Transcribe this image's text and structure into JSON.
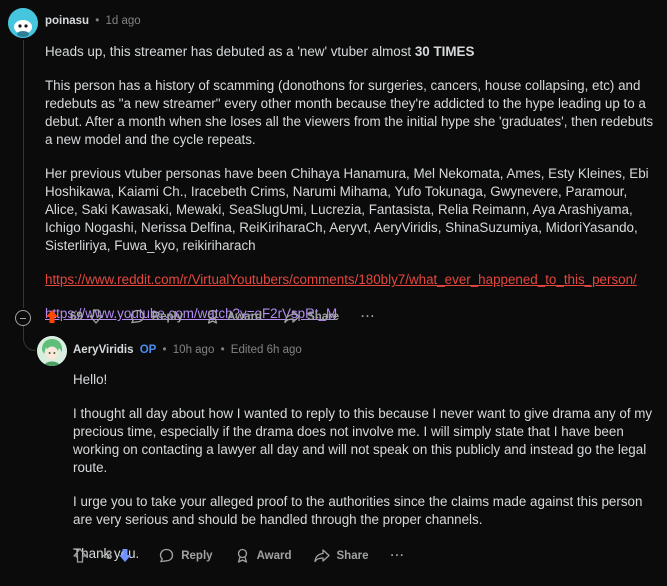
{
  "comment1": {
    "author": "poinasu",
    "separator": "•",
    "time": "1d ago",
    "paragraphs": {
      "p1_pre": "Heads up, this streamer has debuted as a 'new' vtuber almost ",
      "p1_bold": "30 TIMES",
      "p2": "This person has a history of scamming (donothons for surgeries, cancers, house collapsing, etc) and redebuts as \"a new streamer\" every other month because they're addicted to the hype leading up to a debut. After a month when she loses all the viewers from the initial hype she 'graduates', then redebuts a new model and the cycle repeats.",
      "p3": "Her previous vtuber personas have been Chihaya Hanamura, Mel Nekomata, Ames, Esty Kleines, Ebi Hoshikawa, Kaiami Ch., Iracebeth Crims, Narumi Mihama, Yufo Tokunaga, Gwynevere, Paramour, Alice, Saki Kawasaki, Mewaki, SeaSlugUmi, Lucrezia, Fantasista, Relia Reimann, Aya Arashiyama, Ichigo Nogashi, Nerissa Delfina, ReiKiriharaCh, Aeryvt, AeryViridis, ShinaSuzumiya, MidoriYasando, Sisterliriya, Fuwa_kyo, reikiriharach",
      "link1": "https://www.reddit.com/r/VirtualYoutubers/comments/180bly7/what_ever_happened_to_this_person/",
      "link2": "https://www.youtube.com/watch?v=oF2rVspRt_M"
    },
    "actions": {
      "votes": "69",
      "reply": "Reply",
      "award": "Award",
      "share": "Share",
      "more": "···"
    }
  },
  "comment2": {
    "author": "AeryViridis",
    "op_badge": "OP",
    "separator": "•",
    "time": "10h ago",
    "separator2": "•",
    "edited": "Edited 6h ago",
    "paragraphs": {
      "p1": "Hello!",
      "p2": "I thought all day about how I wanted to reply to this because I never want to give drama any of my precious time, especially if the drama does not involve me. I will simply state that I have been working on contacting a lawyer all day and will not speak on this publicly and instead go the legal route.",
      "p3": "I urge you to take your alleged proof to the authorities since the claims made against this person are very serious and should be handled through the proper channels.",
      "p4": "Thank you."
    },
    "actions": {
      "votes": "-3",
      "reply": "Reply",
      "award": "Award",
      "share": "Share",
      "more": "···"
    }
  },
  "colors": {
    "background": "#0b0b0b",
    "upvote_active": "#ff4500",
    "downvote_active": "#7193ff",
    "link_red": "#e6473f",
    "link_purple": "#b48cf2",
    "op_blue": "#4c8cf2"
  }
}
